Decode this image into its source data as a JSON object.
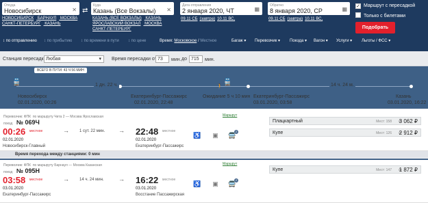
{
  "search": {
    "from_label": "Откуда",
    "from_value": "Новосибирск",
    "from_quick": [
      "НОВОСИБИРСК",
      "БАРНАУЛ",
      "МОСКВА",
      "САНКТ-ПЕТЕРБУРГ",
      "КАЗАНЬ"
    ],
    "to_label": "Куда",
    "to_value": "Казань (Все Вокзалы)",
    "to_quick": [
      "КАЗАНЬ (ВСЕ ВОКЗАЛЫ)",
      "КАЗАНЬ",
      "ЯРОСЛАВСКИЙ ВОКЗАЛ",
      "МОСКВА",
      "САНКТ-ПЕТЕРБУРГ"
    ],
    "depart_label": "Дата отправления",
    "depart_value": "2 января 2020, ЧТ",
    "depart_hints": [
      "09.11 СБ",
      "(завтра)",
      "10.11 ВС,"
    ],
    "return_label": "Обратно",
    "return_value": "8 января 2020, СР",
    "return_hints": [
      "09.11 СБ",
      "(завтра)",
      "10.11 ВС,"
    ],
    "check_transfer": "Маршрут с пересадкой",
    "check_tickets": "Только с билетами",
    "submit": "Подобрать"
  },
  "sortbar": {
    "items": [
      "по отправлению",
      "по прибытию",
      "по времени в пути",
      "по цене"
    ],
    "time_label": "Время:",
    "time_moscow": "Московское",
    "time_local": "Местное",
    "filters": [
      "Багаж",
      "Перевозчик",
      "Поезда",
      "Вагон",
      "Услуги",
      "Льготы / ФСС"
    ]
  },
  "filter": {
    "station_label": "Станция пересадки:",
    "station_value": "Любая",
    "time_label": "Время пересадки от",
    "time_from": "73",
    "time_unit1": "мин.",
    "time_to_label": "до",
    "time_to": "715",
    "time_unit2": "мин."
  },
  "route": {
    "total": "ВСЕГО В ПУТИ: 43 Ч 56 МИН",
    "leg1_duration": "1 дн. 22 ч.",
    "leg2_duration": "14 ч. 24 м.",
    "from_city": "Новосибирск",
    "from_date": "02.01.2020, 00:26",
    "mid1_city": "Екатеринбург-Пассажирс",
    "mid1_date": "02.01.2020, 22:48",
    "wait": "Ожидание 5 ч 10 мин",
    "mid2_city": "Екатеринбург-Пассажирс",
    "mid2_date": "03.01.2020, 03:58",
    "to_city": "Казань",
    "to_date": "03.01.2020, 16:22"
  },
  "trains": [
    {
      "carrier": "Перевозчик: ФПК",
      "route_text": "по маршруту Чита 2 — Москва Ярославская",
      "train_label": "поезд",
      "number": "№ 069Ч",
      "dep_time": "00:26",
      "dep_tz": "местное",
      "dep_date": "02.01.2020",
      "dep_station": "Новосибирск-Главный",
      "duration": "1 сут. 22 мин.",
      "arr_time": "22:48",
      "arr_tz": "местное",
      "arr_date": "02.01.2020",
      "arr_station": "Екатеринбург-Пассажирс",
      "route_link": "Маршрут",
      "badge": "2",
      "seats": [
        {
          "name": "Плацкартный",
          "places": "Мест: 158",
          "from": "от",
          "price": "3 062 ₽"
        },
        {
          "name": "Купе",
          "places": "Мест: 126",
          "from": "от",
          "price": "2 912 ₽"
        }
      ]
    },
    {
      "carrier": "Перевозчик: ФПК",
      "route_text": "по маршруту Барнаул — Москва Казанская",
      "train_label": "поезд",
      "number": "№ 095Н",
      "dep_time": "03:58",
      "dep_tz": "местное",
      "dep_date": "03.01.2020",
      "dep_station": "Екатеринбург-Пассажирс",
      "duration": "14 ч. 24 мин.",
      "arr_time": "16:22",
      "arr_tz": "местное",
      "arr_date": "03.01.2020",
      "arr_station": "Восстание Пассажирская",
      "route_link": "Маршрут",
      "badge": "2",
      "seats": [
        {
          "name": "Купе",
          "places": "Мест: 147",
          "from": "от",
          "price": "1 872 ₽"
        }
      ]
    }
  ],
  "transfer_text": "Время перехода между станциями: 0 мин"
}
